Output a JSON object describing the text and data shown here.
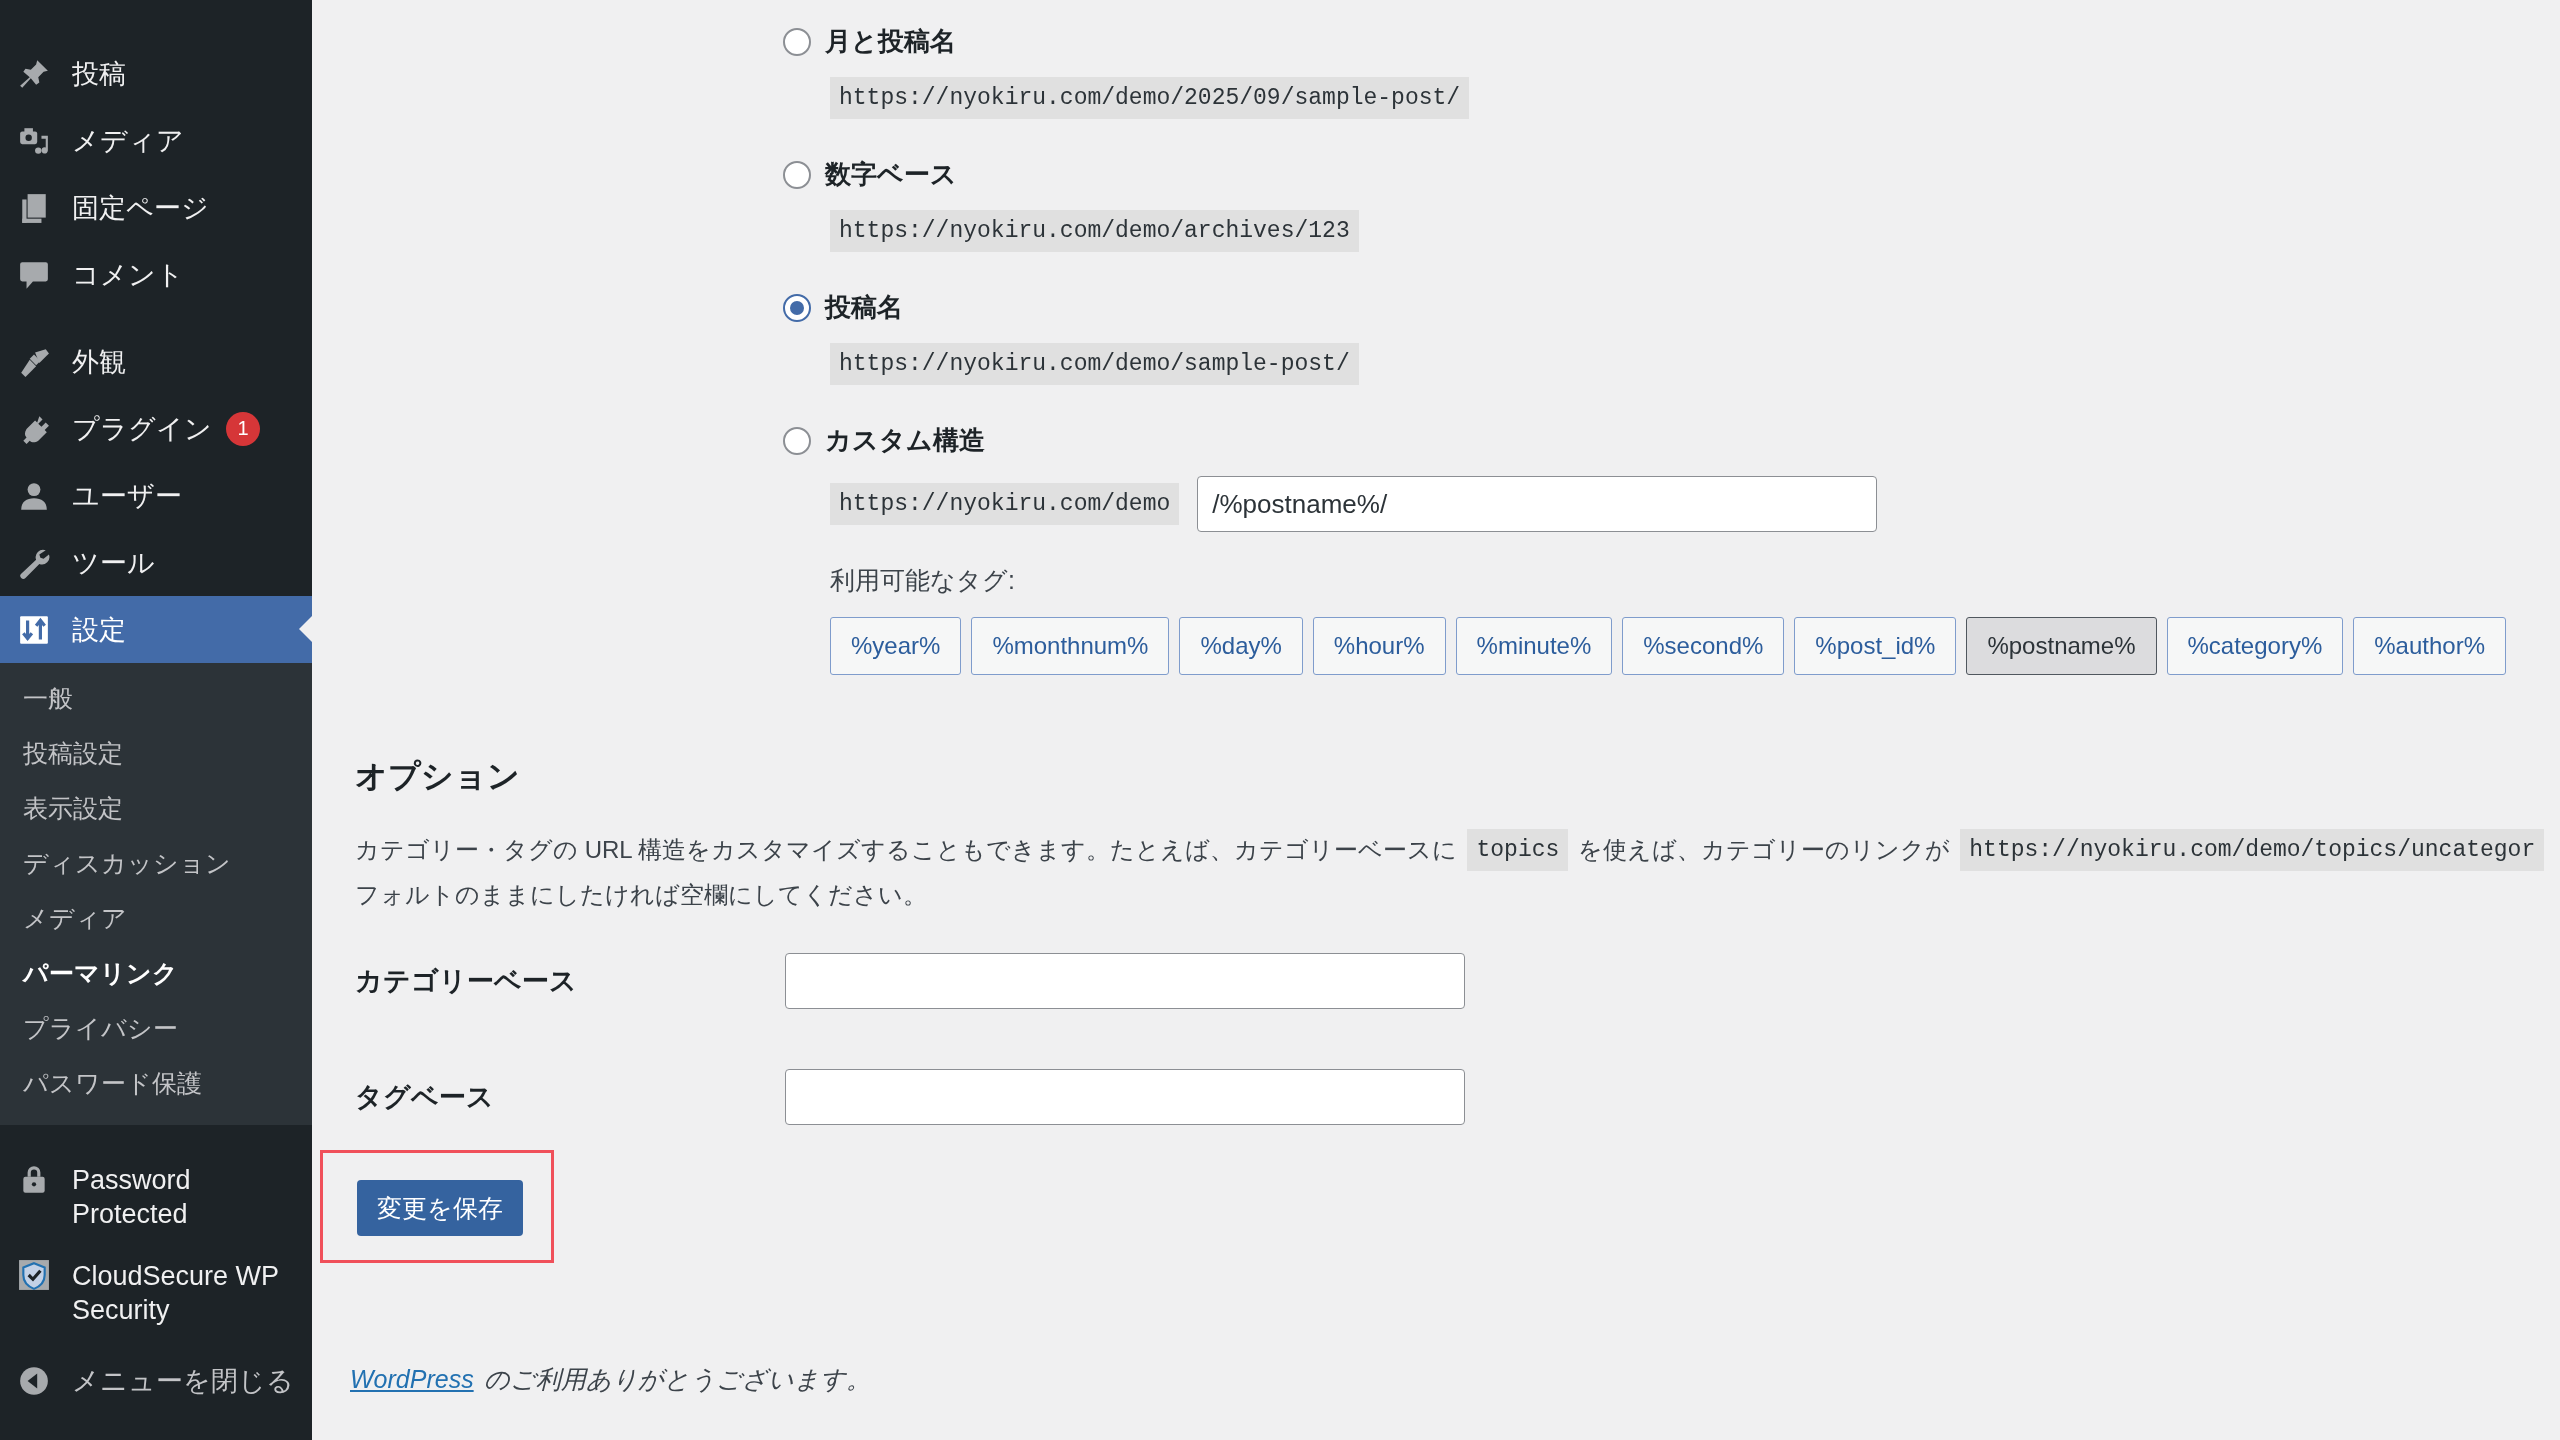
{
  "sidebar": {
    "menu": [
      {
        "label": "投稿",
        "selected": false
      },
      {
        "label": "メディア",
        "selected": false
      },
      {
        "label": "固定ページ",
        "selected": false
      },
      {
        "label": "コメント",
        "selected": false
      },
      {
        "label": "外観",
        "selected": false
      },
      {
        "label": "プラグイン",
        "selected": false,
        "badge": "1"
      },
      {
        "label": "ユーザー",
        "selected": false
      },
      {
        "label": "ツール",
        "selected": false
      },
      {
        "label": "設定",
        "selected": true,
        "children": [
          {
            "label": "一般",
            "selected": false
          },
          {
            "label": "投稿設定",
            "selected": false
          },
          {
            "label": "表示設定",
            "selected": false
          },
          {
            "label": "ディスカッション",
            "selected": false
          },
          {
            "label": "メディア",
            "selected": false
          },
          {
            "label": "パーマリンク",
            "selected": true
          },
          {
            "label": "プライバシー",
            "selected": false
          },
          {
            "label": "パスワード保護",
            "selected": false
          }
        ]
      },
      {
        "label": "Password Protected",
        "selected": false
      },
      {
        "label": "CloudSecure WP Security",
        "selected": false
      }
    ],
    "collapse": {
      "label": "メニューを閉じる"
    }
  },
  "permalink_options": [
    {
      "label": "月と投稿名",
      "example": "https://nyokiru.com/demo/2025/09/sample-post/",
      "selected": false
    },
    {
      "label": "数字ベース",
      "example": "https://nyokiru.com/demo/archives/123",
      "selected": false
    },
    {
      "label": "投稿名",
      "example": "https://nyokiru.com/demo/sample-post/",
      "selected": true
    },
    {
      "label": "カスタム構造",
      "prefix": "https://nyokiru.com/demo",
      "value": "/%postname%/",
      "selected": false
    }
  ],
  "available_tags": {
    "label": "利用可能なタグ:",
    "tags": [
      {
        "label": "%year%",
        "selected": false
      },
      {
        "label": "%monthnum%",
        "selected": false
      },
      {
        "label": "%day%",
        "selected": false
      },
      {
        "label": "%hour%",
        "selected": false
      },
      {
        "label": "%minute%",
        "selected": false
      },
      {
        "label": "%second%",
        "selected": false
      },
      {
        "label": "%post_id%",
        "selected": false
      },
      {
        "label": "%postname%",
        "selected": true
      },
      {
        "label": "%category%",
        "selected": false
      },
      {
        "label": "%author%",
        "selected": false
      }
    ]
  },
  "options": {
    "title": "オプション",
    "description": [
      {
        "kind": "text",
        "text": "カテゴリー・タグの URL 構造をカスタマイズすることもできます。たとえば、カテゴリーベースに"
      },
      {
        "kind": "code",
        "text": "topics"
      },
      {
        "kind": "text",
        "text": "を使えば、カテゴリーのリンクが"
      },
      {
        "kind": "code",
        "text": "https://nyokiru.com/demo/topics/uncategor"
      }
    ],
    "description_line_2": "フォルトのままにしたければ空欄にしてください。",
    "fields": [
      {
        "label": "カテゴリーベース"
      },
      {
        "label": "タグベース"
      }
    ]
  },
  "save_button": {
    "label": "変更を保存",
    "highlighted": true
  },
  "footer": {
    "link": "WordPress",
    "text": "のご利用ありがとうございます。"
  }
}
